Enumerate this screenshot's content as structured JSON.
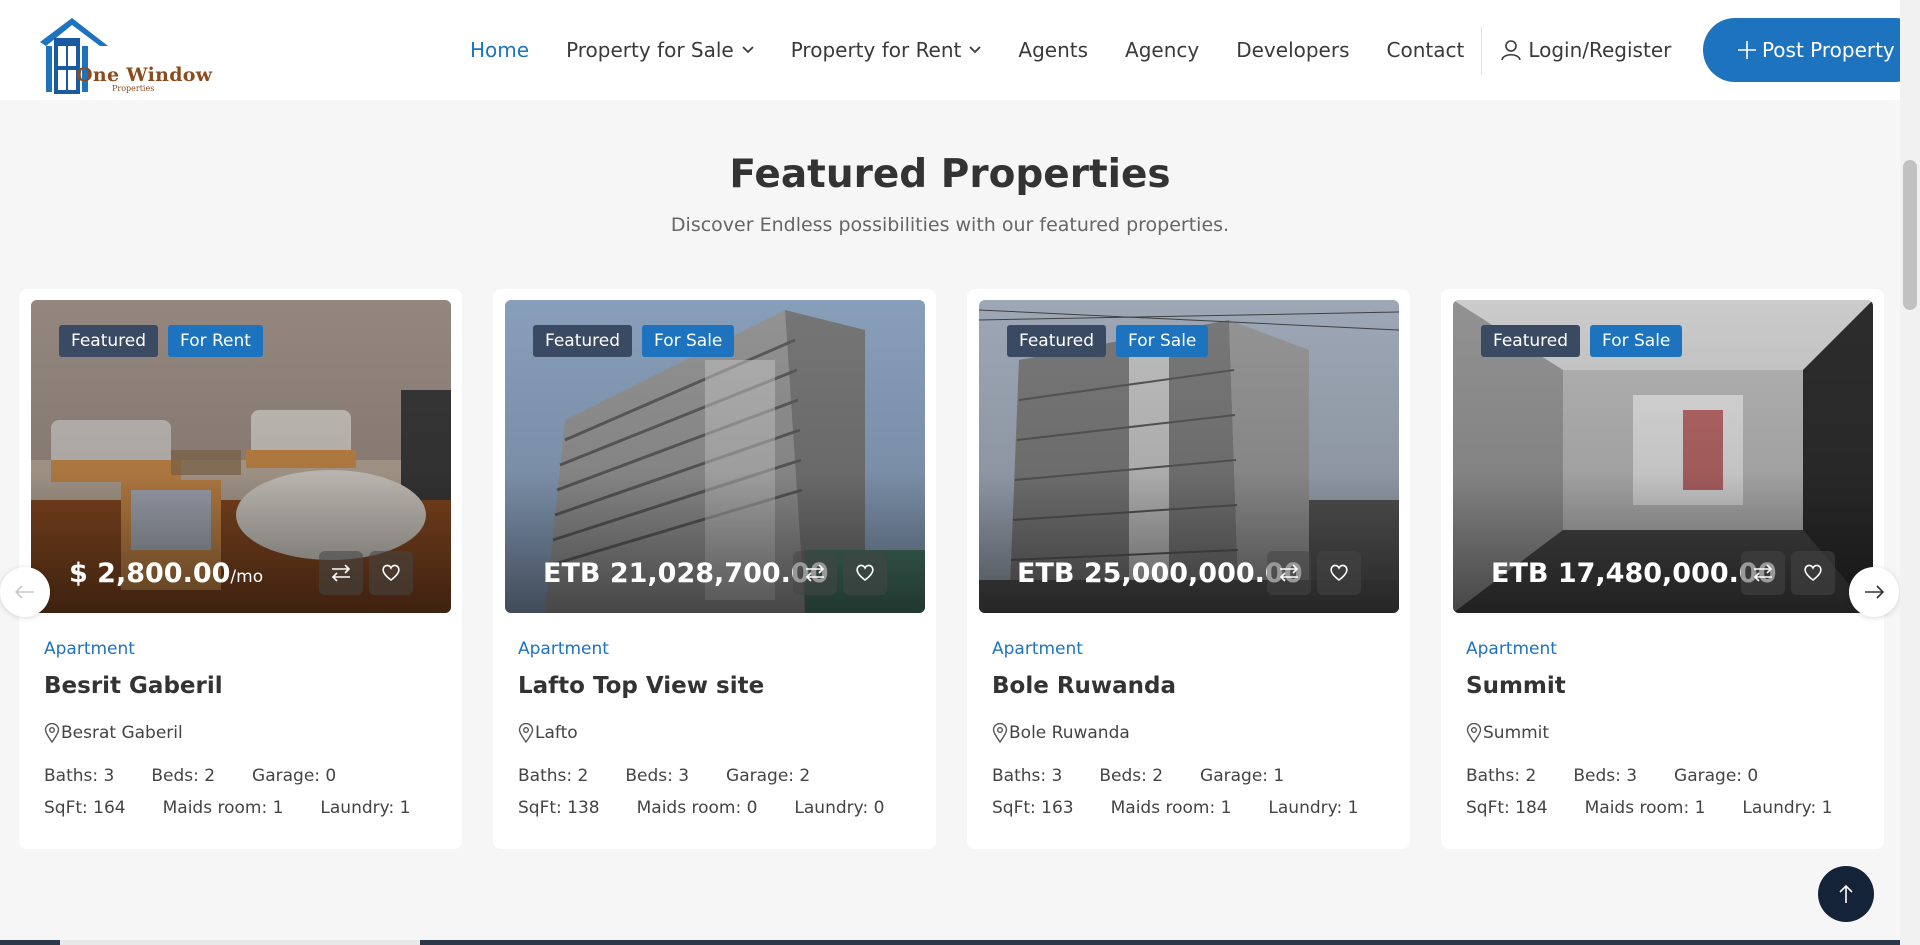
{
  "brand": {
    "name": "One Window",
    "sub": "Properties"
  },
  "nav": {
    "items": [
      {
        "label": "Home",
        "active": true,
        "dropdown": false
      },
      {
        "label": "Property for Sale",
        "active": false,
        "dropdown": true
      },
      {
        "label": "Property for Rent",
        "active": false,
        "dropdown": true
      },
      {
        "label": "Agents",
        "active": false,
        "dropdown": false
      },
      {
        "label": "Agency",
        "active": false,
        "dropdown": false
      },
      {
        "label": "Developers",
        "active": false,
        "dropdown": false
      },
      {
        "label": "Contact",
        "active": false,
        "dropdown": false
      }
    ],
    "login_label": "Login/Register",
    "post_label": "Post Property"
  },
  "section": {
    "title": "Featured Properties",
    "subtitle": "Discover Endless possibilities with our featured properties."
  },
  "cards": [
    {
      "featured_label": "Featured",
      "status": "For Rent",
      "price": "$ 2,800.00",
      "period": "/mo",
      "type": "Apartment",
      "title": "Besrit Gaberil",
      "location": "Besrat Gaberil",
      "baths": "Baths: 3",
      "beds": "Beds: 2",
      "garage": "Garage: 0",
      "sqft": "SqFt: 164",
      "maids": "Maids room: 1",
      "laundry": "Laundry: 1",
      "image": "living-room-photo"
    },
    {
      "featured_label": "Featured",
      "status": "For Sale",
      "price": "ETB 21,028,700.00",
      "period": "",
      "type": "Apartment",
      "title": "Lafto Top View site",
      "location": "Lafto",
      "baths": "Baths: 2",
      "beds": "Beds: 3",
      "garage": "Garage: 2",
      "sqft": "SqFt: 138",
      "maids": "Maids room: 0",
      "laundry": "Laundry: 0",
      "image": "tower-building-photo"
    },
    {
      "featured_label": "Featured",
      "status": "For Sale",
      "price": "ETB 25,000,000.00",
      "period": "",
      "type": "Apartment",
      "title": "Bole Ruwanda",
      "location": "Bole Ruwanda",
      "baths": "Baths: 3",
      "beds": "Beds: 2",
      "garage": "Garage: 1",
      "sqft": "SqFt: 163",
      "maids": "Maids room: 1",
      "laundry": "Laundry: 1",
      "image": "building-street-photo"
    },
    {
      "featured_label": "Featured",
      "status": "For Sale",
      "price": "ETB 17,480,000.00",
      "period": "",
      "type": "Apartment",
      "title": "Summit",
      "location": "Summit",
      "baths": "Baths: 2",
      "beds": "Beds: 3",
      "garage": "Garage: 0",
      "sqft": "SqFt: 184",
      "maids": "Maids room: 1",
      "laundry": "Laundry: 1",
      "image": "empty-interior-photo"
    }
  ],
  "colors": {
    "accent": "#1e73be",
    "badge_featured": "#3a4a63",
    "to_top": "#142337",
    "brand_text": "#8a4b1e"
  },
  "icons": [
    "user-icon",
    "plus-icon",
    "chevron-down-icon",
    "compare-icon",
    "heart-icon",
    "map-pin-icon",
    "arrow-left-icon",
    "arrow-right-icon",
    "arrow-up-icon"
  ]
}
